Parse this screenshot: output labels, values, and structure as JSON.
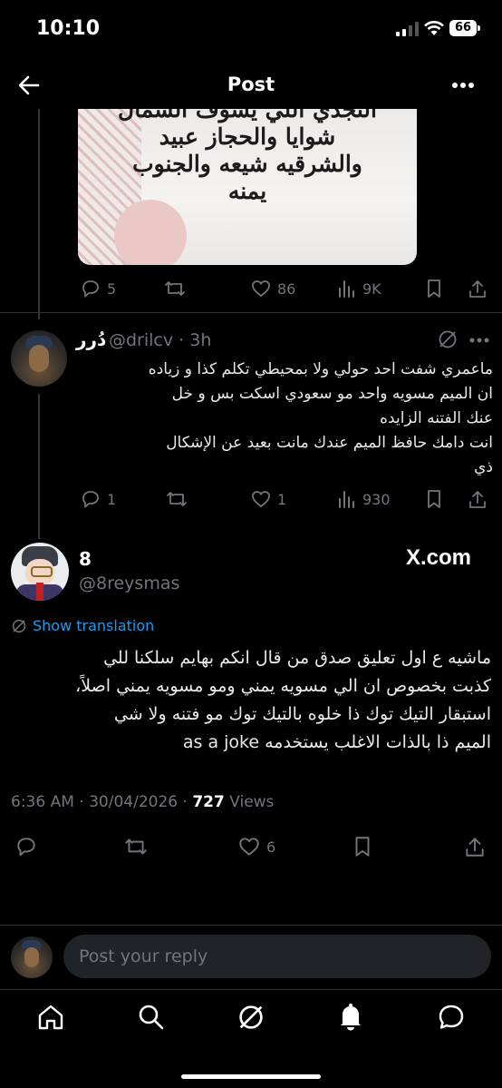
{
  "status_bar": {
    "time": "10:10",
    "battery": "66"
  },
  "header": {
    "title": "Post"
  },
  "image_tweet": {
    "image_caption_lines": [
      "النجدي اللي يشوف الشمال",
      "شوايا والحجاز عبيد",
      "والشرقيه شيعه والجنوب",
      "يمنه"
    ],
    "replies": "5",
    "likes": "86",
    "views": "9K"
  },
  "reply1": {
    "name": "دُرر",
    "handle": "@drilcv",
    "time": "3h",
    "text_lines": [
      "ماعمري شفت احد حولي ولا بمحيطي تكلم كذا و زياده",
      "ان الميم مسويه واحد مو سعودي اسكت بس و خل",
      "عنك الفتنه الزايده",
      "انت دامك حافظ الميم عندك مانت بعيد عن الإشكال",
      "ذي"
    ],
    "replies": "1",
    "likes": "1",
    "views": "930"
  },
  "main_post": {
    "name": "8",
    "handle": "@8reysmas",
    "watermark": "X.com",
    "show_translation": "Show translation",
    "text_lines": [
      "ماشيه ع اول تعليق صدق من قال انكم بهايم سلكنا للي",
      "كذبت بخصوص ان الي مسويه يمني ومو مسويه يمني اصلاً،",
      "استبقار التيك توك ذا خلوه بالتيك توك مو فتنه ولا شي",
      "الميم ذا بالذات الاغلب يستخدمه as a joke"
    ],
    "time": "6:36 AM",
    "date": "30/04/2026",
    "views_count": "727",
    "views_label": "Views",
    "likes": "6"
  },
  "reply_bar": {
    "placeholder": "Post your reply"
  },
  "tab_bar": [
    "home-icon",
    "search-icon",
    "grok-icon",
    "notifications-icon",
    "messages-icon"
  ],
  "colors": {
    "background": "#000000",
    "text": "#e7e9ea",
    "muted": "#71767b",
    "link": "#1d9bf0"
  }
}
